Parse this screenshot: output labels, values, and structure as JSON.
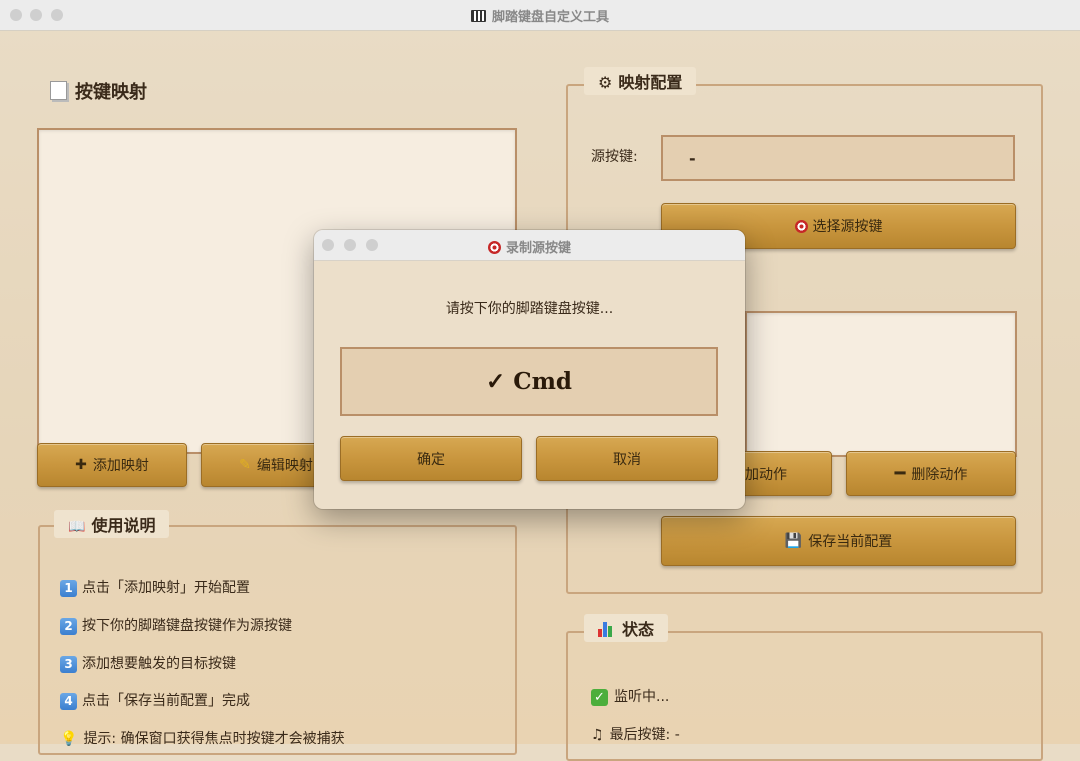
{
  "window": {
    "title": "脚踏键盘自定义工具"
  },
  "left": {
    "heading": "按键映射",
    "buttons": {
      "add": "添加映射",
      "edit": "编辑映射"
    },
    "instructions": {
      "legend": "使用说明",
      "items": [
        {
          "num": "1",
          "text": "点击「添加映射」开始配置"
        },
        {
          "num": "2",
          "text": "按下你的脚踏键盘按键作为源按键"
        },
        {
          "num": "3",
          "text": "添加想要触发的目标按键"
        },
        {
          "num": "4",
          "text": "点击「保存当前配置」完成"
        }
      ],
      "hint": "提示: 确保窗口获得焦点时按键才会被捕获"
    }
  },
  "right": {
    "config": {
      "legend": "映射配置",
      "source_label": "源按键:",
      "source_value": "-",
      "select_button": "选择源按键",
      "add_action": "加动作",
      "delete_action": "删除动作",
      "save_button": "保存当前配置"
    },
    "status": {
      "legend": "状态",
      "listening": "监听中...",
      "last_key": "最后按键: -"
    }
  },
  "dialog": {
    "title": "录制源按键",
    "prompt": "请按下你的脚踏键盘按键...",
    "captured": "✓ Cmd",
    "ok": "确定",
    "cancel": "取消"
  }
}
